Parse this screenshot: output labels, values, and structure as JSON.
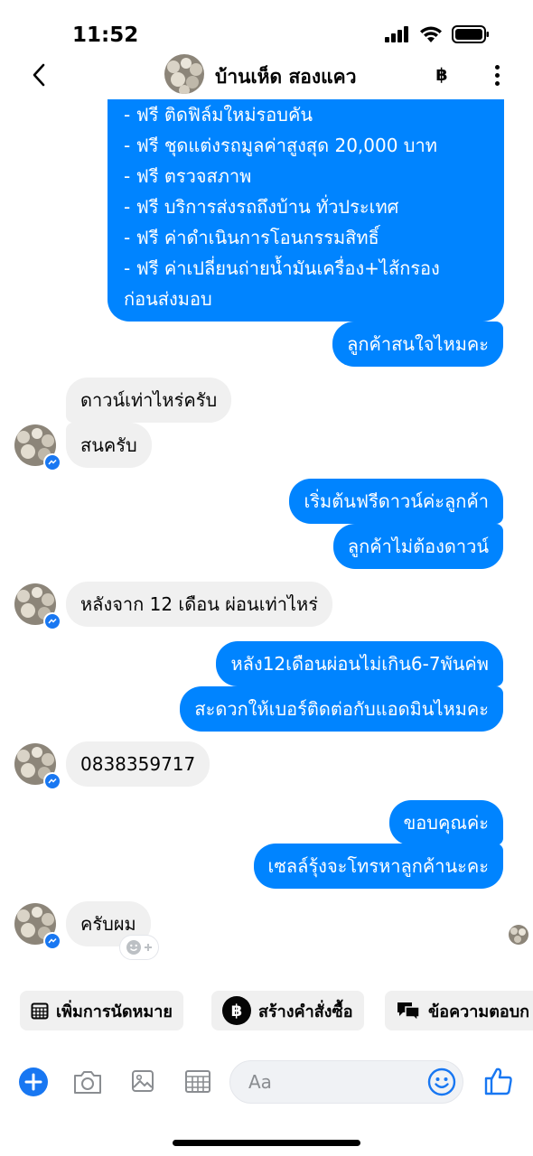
{
  "status_bar": {
    "time": "11:52"
  },
  "header": {
    "title": "บ้านเห็ด สองแคว",
    "currency_icon": "฿"
  },
  "messages": {
    "promo_lines": [
      " - ฟรี ติดฟิล์มใหม่รอบคัน",
      " - ฟรี ชุดแต่งรถมูลค่าสูงสุด 20,000 บาท",
      " - ฟรี ตรวจสภาพ",
      " - ฟรี บริการส่งรถถึงบ้าน ทั่วประเทศ",
      " - ฟรี ค่าดำเนินการโอนกรรมสิทธิ์",
      " - ฟรี ค่าเปลี่ยนถ่ายน้ำมันเครื่อง+ไส้กรอง",
      "ก่อนส่งมอบ"
    ],
    "out_1": "ลูกค้าสนใจไหมคะ",
    "in_1": "ดาวน์เท่าไหร่ครับ",
    "in_2": "สนครับ",
    "out_2": "เริ่มต้นฟรีดาวน์ค่ะลูกค้า",
    "out_3": "ลูกค้าไม่ต้องดาวน์",
    "in_3": "หลังจาก 12 เดือน ผ่อนเท่าไหร่",
    "out_4": "หลัง12เดือนผ่อนไม่เกิน6-7พันค่พ",
    "out_5": "สะดวกให้เบอร์ติดต่อกับแอดมินไหมคะ",
    "in_4": "0838359717",
    "out_6": "ขอบคุณค่ะ",
    "out_7": "เซลล์รุ้งจะโทรหาลูกค้านะคะ",
    "in_5": "ครับผม"
  },
  "quick_actions": {
    "appointment": "เพิ่มการนัดหมาย",
    "create_order": "สร้างคำสั่งซื้อ",
    "order_icon": "฿",
    "auto_reply": "ข้อความตอบก"
  },
  "composer": {
    "placeholder": "Aa"
  },
  "colors": {
    "accent": "#0084ff",
    "incoming": "#f0f0f0",
    "icon_blue": "#1877f2"
  }
}
